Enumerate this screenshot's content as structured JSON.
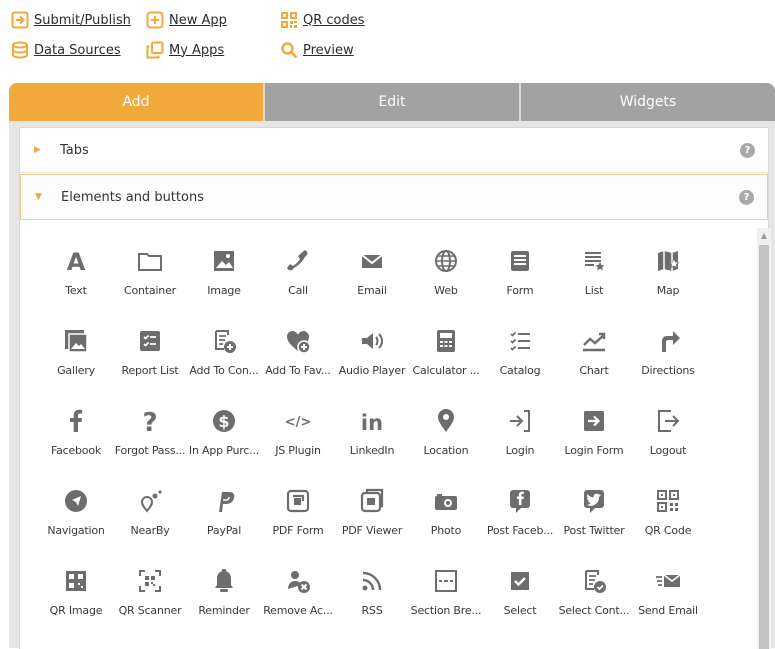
{
  "top_links": [
    {
      "label": "Submit/Publish",
      "icon": "submit-arrow-icon"
    },
    {
      "label": "New App",
      "icon": "plus-box-icon"
    },
    {
      "label": "QR codes",
      "icon": "qr-code-icon"
    },
    {
      "label": "Data Sources",
      "icon": "database-icon"
    },
    {
      "label": "My Apps",
      "icon": "copy-icon"
    },
    {
      "label": "Preview",
      "icon": "magnifier-icon"
    }
  ],
  "tabs": [
    {
      "label": "Add",
      "active": true
    },
    {
      "label": "Edit",
      "active": false
    },
    {
      "label": "Widgets",
      "active": false
    }
  ],
  "accordion": {
    "tabs_section": {
      "label": "Tabs",
      "expanded": false,
      "help": "?"
    },
    "elements_section": {
      "label": "Elements and buttons",
      "expanded": true,
      "help": "?"
    }
  },
  "colors": {
    "accent": "#f2a93b",
    "tab_inactive": "#a2a2a2",
    "icon": "#6d6d6d"
  },
  "elements": [
    {
      "label": "Text",
      "icon": "text-icon"
    },
    {
      "label": "Container",
      "icon": "folder-icon"
    },
    {
      "label": "Image",
      "icon": "image-icon"
    },
    {
      "label": "Call",
      "icon": "phone-icon"
    },
    {
      "label": "Email",
      "icon": "envelope-icon"
    },
    {
      "label": "Web",
      "icon": "globe-icon"
    },
    {
      "label": "Form",
      "icon": "form-icon"
    },
    {
      "label": "List",
      "icon": "list-icon"
    },
    {
      "label": "Map",
      "icon": "map-icon"
    },
    {
      "label": "Gallery",
      "icon": "gallery-icon"
    },
    {
      "label": "Report List",
      "icon": "report-list-icon"
    },
    {
      "label": "Add To Con...",
      "icon": "add-contact-icon"
    },
    {
      "label": "Add To Fav...",
      "icon": "add-favorite-icon"
    },
    {
      "label": "Audio Player",
      "icon": "speaker-icon"
    },
    {
      "label": "Calculator ...",
      "icon": "calculator-icon"
    },
    {
      "label": "Catalog",
      "icon": "catalog-icon"
    },
    {
      "label": "Chart",
      "icon": "chart-icon"
    },
    {
      "label": "Directions",
      "icon": "directions-icon"
    },
    {
      "label": "Facebook",
      "icon": "facebook-icon"
    },
    {
      "label": "Forgot Pass...",
      "icon": "question-icon"
    },
    {
      "label": "In App Purc...",
      "icon": "dollar-icon"
    },
    {
      "label": "JS Plugin",
      "icon": "code-icon"
    },
    {
      "label": "LinkedIn",
      "icon": "linkedin-icon"
    },
    {
      "label": "Location",
      "icon": "location-pin-icon"
    },
    {
      "label": "Login",
      "icon": "login-icon"
    },
    {
      "label": "Login Form",
      "icon": "login-form-icon"
    },
    {
      "label": "Logout",
      "icon": "logout-icon"
    },
    {
      "label": "Navigation",
      "icon": "navigation-icon"
    },
    {
      "label": "NearBy",
      "icon": "nearby-icon"
    },
    {
      "label": "PayPal",
      "icon": "paypal-icon"
    },
    {
      "label": "PDF Form",
      "icon": "pdf-form-icon"
    },
    {
      "label": "PDF Viewer",
      "icon": "pdf-viewer-icon"
    },
    {
      "label": "Photo",
      "icon": "camera-icon"
    },
    {
      "label": "Post Faceb...",
      "icon": "post-facebook-icon"
    },
    {
      "label": "Post Twitter",
      "icon": "post-twitter-icon"
    },
    {
      "label": "QR Code",
      "icon": "qr-code-icon"
    },
    {
      "label": "QR Image",
      "icon": "qr-image-icon"
    },
    {
      "label": "QR Scanner",
      "icon": "qr-scanner-icon"
    },
    {
      "label": "Reminder",
      "icon": "bell-icon"
    },
    {
      "label": "Remove Ac...",
      "icon": "remove-account-icon"
    },
    {
      "label": "RSS",
      "icon": "rss-icon"
    },
    {
      "label": "Section Bre...",
      "icon": "section-break-icon"
    },
    {
      "label": "Select",
      "icon": "checkbox-icon"
    },
    {
      "label": "Select Cont...",
      "icon": "select-contact-icon"
    },
    {
      "label": "Send Email",
      "icon": "send-email-icon"
    }
  ]
}
